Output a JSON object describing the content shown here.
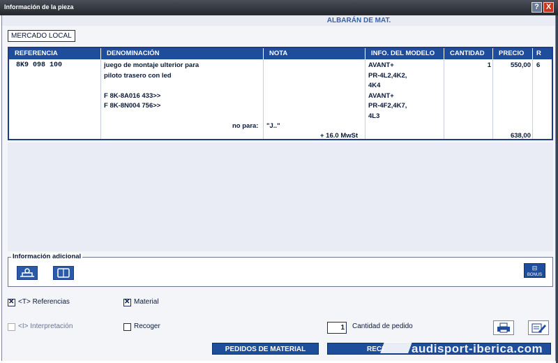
{
  "window": {
    "title": "Información de la pieza",
    "help_label": "?",
    "close_label": "X"
  },
  "document_type": "ALBARÁN DE MAT.",
  "market_button": "MERCADO LOCAL",
  "table": {
    "headers": [
      "REFERENCIA",
      "DENOMINACIÓN",
      "NOTA",
      "INFO. DEL MODELO",
      "CANTIDAD",
      "PRECIO",
      "R"
    ],
    "row": {
      "reference": "8K9  098  100",
      "description": [
        "juego de montaje ulterior para",
        "piloto trasero con led",
        "",
        "F 8K-8A016 433>>",
        "F 8K-8N004 756>>"
      ],
      "note_label": "no para:",
      "note_value": "\"J..\"",
      "model_info": [
        "AVANT+",
        "PR-4L2,4K2,",
        "4K4",
        "AVANT+",
        "PR-4F2,4K7,",
        "4L3"
      ],
      "quantity": "1",
      "price": "550,00",
      "r": "6",
      "tax_label": "+  16.0 MwSt",
      "total": "638,00"
    }
  },
  "additional_info": {
    "legend": "Información adicional",
    "bonus_label": "BONUS"
  },
  "options": {
    "referencias": {
      "label": "<T> Referencias",
      "checked": true
    },
    "material": {
      "label": "Material",
      "checked": true
    },
    "interpretacion": {
      "label": "<I> Interpretación",
      "checked": false,
      "disabled": true
    },
    "recoger": {
      "label": "Recoger",
      "checked": false
    }
  },
  "order_quantity": {
    "value": "1",
    "label": "Cantidad de pedido"
  },
  "buttons": {
    "pedidos": "PEDIDOS DE MATERIAL",
    "recibir": "RECI"
  },
  "watermark": "audisport-iberica.com",
  "icons": [
    "help-icon",
    "close-icon",
    "parts-icon",
    "book-icon",
    "bonus-icon",
    "printer-icon",
    "edit-icon"
  ],
  "colors": {
    "header_blue": "#1e4d9c",
    "titlebar": "#2c2f36",
    "close_red": "#c8361e",
    "panel": "#e9ecf5"
  }
}
